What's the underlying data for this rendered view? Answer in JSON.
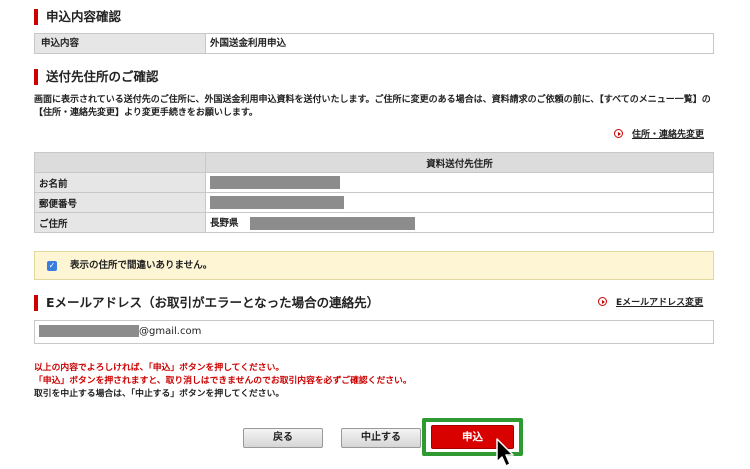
{
  "application": {
    "heading": "申込内容確認",
    "label": "申込内容",
    "value": "外国送金利用申込"
  },
  "address_section": {
    "heading": "送付先住所のご確認",
    "description": "画面に表示されている送付先のご住所に、外国送金利用申込資料を送付いたします。ご住所に変更のある場合は、資料請求のご依頼の前に、【すべてのメニュー一覧】の【住所・連絡先変更】より変更手続きをお願いします。",
    "change_link": "住所・連絡先変更",
    "table": {
      "column_header": "資料送付先住所",
      "rows": [
        {
          "label": "お名前",
          "value": ""
        },
        {
          "label": "郵便番号",
          "value": ""
        },
        {
          "label": "ご住所",
          "value": "長野県"
        }
      ]
    },
    "confirm_checkbox": {
      "checked": true,
      "label": "表示の住所で間違いありません。"
    }
  },
  "email_section": {
    "heading": "Eメールアドレス（お取引がエラーとなった場合の連絡先）",
    "change_link": "Eメールアドレス変更",
    "email_suffix": "@gmail.com"
  },
  "notices": {
    "line1": "以上の内容でよろしければ、「申込」ボタンを押してください。",
    "line2": "「申込」ボタンを押されますと、取り消しはできませんのでお取引内容を必ずご確認ください。",
    "line3": "取引を中止する場合は、「中止する」ボタンを押してください。"
  },
  "buttons": {
    "back": "戻る",
    "cancel": "中止する",
    "submit": "申込"
  },
  "colors": {
    "accent_red": "#cc0000",
    "submit_red": "#d90000",
    "highlight_green": "#2e9a31",
    "confirm_bg": "#fdf5d3",
    "checkbox_blue": "#3b7ddd"
  }
}
